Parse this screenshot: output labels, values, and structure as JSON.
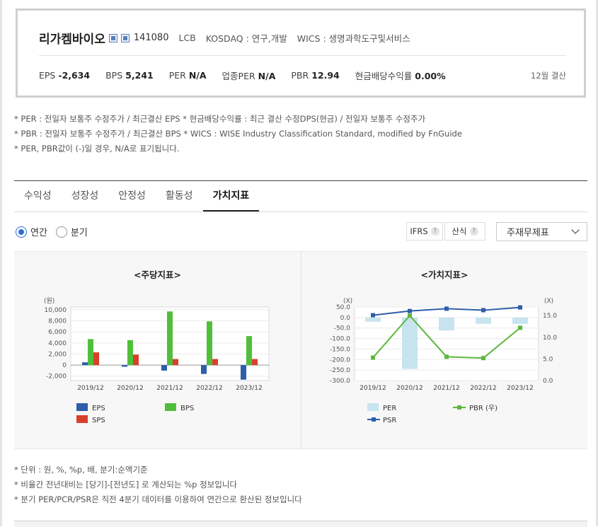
{
  "header": {
    "company": "리가켐바이오",
    "code": "141080",
    "market_class": "LCB",
    "exchange": "KOSDAQ : 연구,개발",
    "wics": "WICS : 생명과학도구및서비스",
    "settlement": "12월 결산",
    "metrics": [
      {
        "label": "EPS",
        "value": "-2,634"
      },
      {
        "label": "BPS",
        "value": "5,241"
      },
      {
        "label": "PER",
        "value": "N/A"
      },
      {
        "label": "업종PER",
        "value": "N/A"
      },
      {
        "label": "PBR",
        "value": "12.94"
      },
      {
        "label": "현금배당수익률",
        "value": "0.00%"
      }
    ]
  },
  "notes": [
    "* PER : 전일자 보통주 수정주가 / 최근결산 EPS * 현금배당수익률 : 최근 결산 수정DPS(현금) / 전일자 보통주 수정주가",
    "* PBR : 전일자 보통주 수정주가 / 최근결산 BPS * WICS : WISE Industry Classification Standard, modified by FnGuide",
    "* PER, PBR값이 (-)일 경우, N/A로 표기됩니다."
  ],
  "tabs": [
    {
      "label": "수익성",
      "active": false
    },
    {
      "label": "성장성",
      "active": false
    },
    {
      "label": "안정성",
      "active": false
    },
    {
      "label": "활동성",
      "active": false
    },
    {
      "label": "가치지표",
      "active": true
    }
  ],
  "period": {
    "annual": "연간",
    "quarter": "분기",
    "selected": "annual"
  },
  "controls": {
    "ifrs": "IFRS",
    "calc": "산식",
    "help": "?",
    "statement": "주재무제표"
  },
  "colors": {
    "eps": "#2e5ea8",
    "bps": "#4fbf3a",
    "sps": "#d9402b",
    "per": "#c7e4ef",
    "psr": "#2e5ea8",
    "pbr": "#5cb83c"
  },
  "chart_data": [
    {
      "type": "bar",
      "title": "<주당지표>",
      "ylabel": "(원)",
      "categories": [
        "2019/12",
        "2020/12",
        "2021/12",
        "2022/12",
        "2023/12"
      ],
      "yticks": [
        "10,000",
        "8,000",
        "6,000",
        "4,000",
        "2,000",
        "0",
        "-2,000"
      ],
      "ylim": [
        -2800,
        10500
      ],
      "series": [
        {
          "name": "EPS",
          "values": [
            500,
            -300,
            -1000,
            -1600,
            -2634
          ]
        },
        {
          "name": "BPS",
          "values": [
            4700,
            4500,
            9700,
            7900,
            5241
          ]
        },
        {
          "name": "SPS",
          "values": [
            2300,
            1900,
            1100,
            1100,
            1100
          ]
        }
      ],
      "legend": "bottom"
    },
    {
      "type": "bar",
      "title": "<가치지표>",
      "ylabel_left": "(X)",
      "ylabel_right": "(X)",
      "categories": [
        "2019/12",
        "2020/12",
        "2021/12",
        "2022/12",
        "2023/12"
      ],
      "yticks_left": [
        "50.0",
        "0.0",
        "-50.0",
        "-100.0",
        "-150.0",
        "-200.0",
        "-250.0",
        "-300.0"
      ],
      "yticks_right": [
        "15.0",
        "10.0",
        "5.0",
        "0.0"
      ],
      "ylim_left": [
        -300,
        50
      ],
      "ylim_right": [
        0,
        17
      ],
      "series": [
        {
          "name": "PER",
          "axis": "left",
          "kind": "bar",
          "values": [
            -20,
            -245,
            -62,
            -30,
            -30
          ]
        },
        {
          "name": "PBR (우)",
          "axis": "right",
          "kind": "line",
          "values": [
            5.3,
            15.0,
            5.5,
            5.2,
            12.2
          ]
        },
        {
          "name": "PSR",
          "axis": "left",
          "kind": "line",
          "values": [
            11,
            31,
            42,
            35,
            48
          ]
        }
      ],
      "legend": "bottom"
    }
  ],
  "footnotes": [
    "* 단위 : 원, %, %p, 배, 분기:순액기준",
    "* 비율간 전년대비는 [당기]-[전년도] 로 계산되는 %p 정보입니다",
    "* 분기 PER/PCR/PSR은 직전 4분기 데이터를 이용하여 연간으로 환산된 정보입니다"
  ]
}
